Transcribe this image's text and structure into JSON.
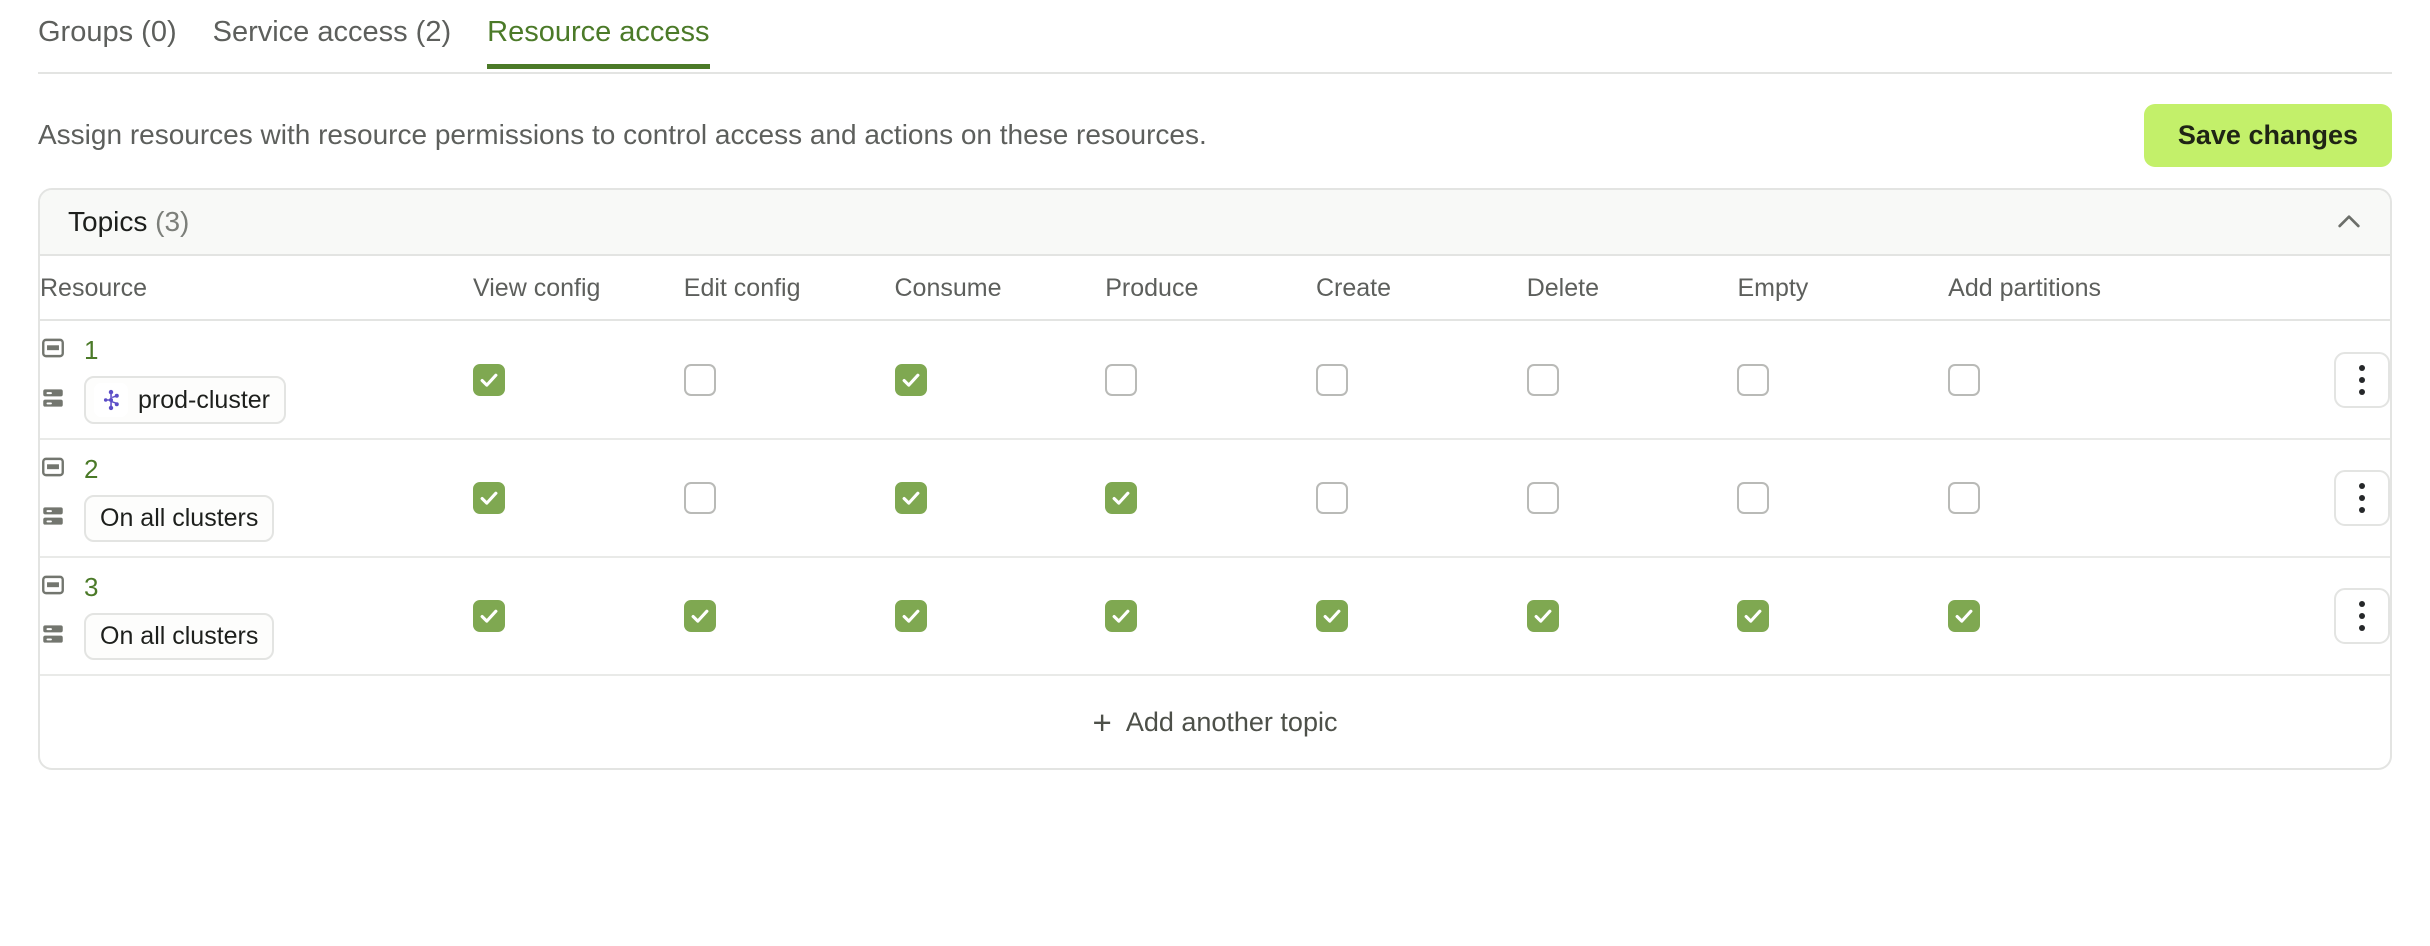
{
  "tabs": [
    {
      "label": "Groups (0)",
      "active": false
    },
    {
      "label": "Service access (2)",
      "active": false
    },
    {
      "label": "Resource access",
      "active": true
    }
  ],
  "intro": {
    "description": "Assign resources with resource permissions to control access and actions on these resources.",
    "save_label": "Save changes",
    "save_color": "#c3f06a"
  },
  "card": {
    "title": "Topics",
    "count": "(3)",
    "collapse_icon": "chevron-up-icon",
    "columns": [
      "Resource",
      "View config",
      "Edit config",
      "Consume",
      "Produce",
      "Create",
      "Delete",
      "Empty",
      "Add partitions"
    ],
    "rows": [
      {
        "number": "1",
        "topic_icon": "topic-icon",
        "cluster_icon": "cluster-icon",
        "cluster_label": "prod-cluster",
        "cluster_logo": "kafka-logo-icon",
        "has_logo": true,
        "permissions": [
          true,
          false,
          true,
          false,
          false,
          false,
          false,
          false
        ]
      },
      {
        "number": "2",
        "topic_icon": "topic-icon",
        "cluster_icon": "cluster-icon",
        "cluster_label": "On all clusters",
        "cluster_logo": "",
        "has_logo": false,
        "permissions": [
          true,
          false,
          true,
          true,
          false,
          false,
          false,
          false
        ]
      },
      {
        "number": "3",
        "topic_icon": "topic-icon",
        "cluster_icon": "cluster-icon",
        "cluster_label": "On all clusters",
        "cluster_logo": "",
        "has_logo": false,
        "permissions": [
          true,
          true,
          true,
          true,
          true,
          true,
          true,
          true
        ]
      }
    ],
    "row_menu_icon": "kebab-menu-icon",
    "footer": {
      "add_label": "Add another topic",
      "add_icon": "plus-icon"
    }
  },
  "colors": {
    "accent_green": "#4b7a28",
    "checkbox_checked": "#7fa851",
    "save_button": "#c3f06a",
    "kafka_purple": "#5c4ec7"
  }
}
